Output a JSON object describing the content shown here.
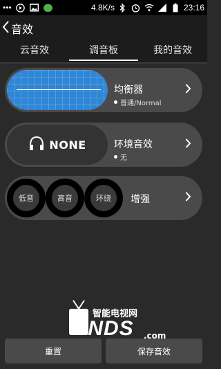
{
  "status_bar": {
    "dots": "•••",
    "network_speed": "4.8K/s",
    "time": "23:16",
    "icons": [
      "play-circle-icon",
      "image-icon",
      "wechat-icon",
      "bluetooth-icon",
      "alarm-icon",
      "wifi-icon",
      "signal-icon",
      "battery-icon"
    ]
  },
  "header": {
    "title": "音效"
  },
  "tabs": [
    {
      "label": "云音效"
    },
    {
      "label": "调音板",
      "active": true
    },
    {
      "label": "我的音效"
    }
  ],
  "cards": {
    "equalizer": {
      "label": "均衡器",
      "value": "普通/Normal"
    },
    "surround": {
      "badge": "NONE",
      "label": "环境音效",
      "value": "无"
    },
    "enhance": {
      "knobs": [
        "低音",
        "高音",
        "环绕"
      ],
      "label": "增强"
    }
  },
  "watermark": {
    "top": "智能电视网",
    "main": "ZNDS",
    "suffix": ".com"
  },
  "buttons": {
    "reset": "重置",
    "save": "保存音效"
  },
  "colors": {
    "accent": "#2f86d6",
    "card": "#4a4a4a",
    "background": "#2a2a2a"
  }
}
